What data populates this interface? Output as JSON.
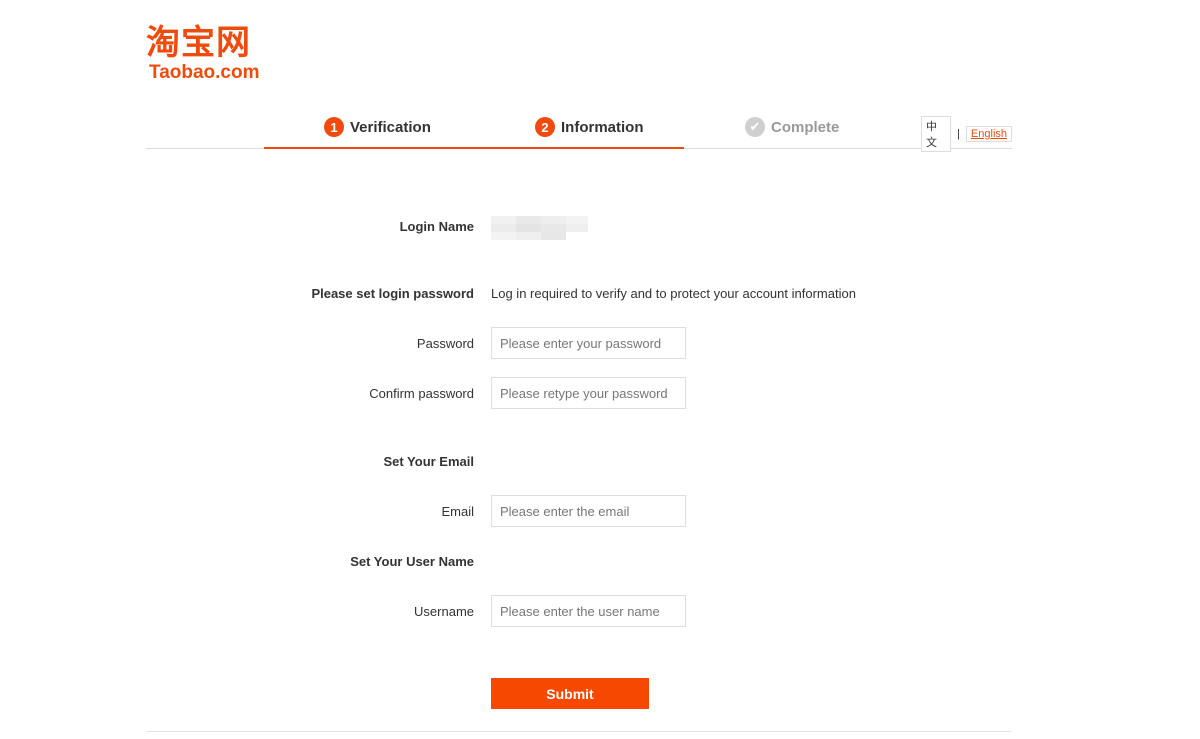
{
  "logo": {
    "cn": "淘宝网",
    "en": "Taobao.com"
  },
  "steps": [
    {
      "num": "1",
      "label": "Verification"
    },
    {
      "num": "2",
      "label": "Information"
    },
    {
      "icon": "check-circle-icon",
      "label": "Complete"
    }
  ],
  "language": {
    "chinese": "中文",
    "separator": "|",
    "english": "English"
  },
  "form": {
    "login_name_label": "Login Name",
    "password_section_label": "Please set login password",
    "password_section_note": "Log in required to verify and to protect your account information",
    "password_label": "Password",
    "password_placeholder": "Please enter your password",
    "confirm_label": "Confirm password",
    "confirm_placeholder": "Please retype your password",
    "email_section_label": "Set Your Email",
    "email_label": "Email",
    "email_placeholder": "Please enter the email",
    "username_section_label": "Set Your User Name",
    "username_label": "Username",
    "username_placeholder": "Please enter the user name",
    "submit_label": "Submit"
  },
  "colors": {
    "accent": "#f04b0e",
    "submit": "#f64800",
    "inactive": "#cfcfcf"
  }
}
